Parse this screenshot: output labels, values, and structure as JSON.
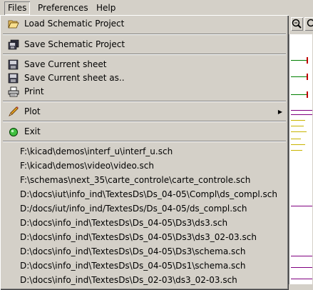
{
  "menubar": {
    "items": [
      {
        "label": "Files"
      },
      {
        "label": "Preferences"
      },
      {
        "label": "Help"
      }
    ]
  },
  "files_menu": {
    "load_project": {
      "label": "Load Schematic Project",
      "icon": "folder-open-icon"
    },
    "save_project": {
      "label": "Save Schematic Project",
      "icon": "save-all-icon"
    },
    "save_sheet": {
      "label": "Save Current sheet",
      "icon": "floppy-disk-icon"
    },
    "save_sheet_as": {
      "label": "Save Current sheet as..",
      "icon": "floppy-disk-icon"
    },
    "print": {
      "label": "Print",
      "icon": "printer-icon"
    },
    "plot": {
      "label": "Plot",
      "icon": "pencil-icon"
    },
    "exit": {
      "label": "Exit",
      "icon": "exit-icon"
    },
    "recent_files": [
      "F:\\kicad\\demos\\interf_u\\interf_u.sch",
      "F:\\kicad\\demos\\video\\video.sch",
      "F:\\schemas\\next_35\\carte_controle\\carte_controle.sch",
      "D:\\docs\\iut\\info_ind\\TextesDs\\Ds_04-05\\Compl\\ds_compl.sch",
      "D:/docs/iut/info_ind/TextesDs/Ds_04-05/ds_compl.sch",
      "D:\\docs\\info_ind\\TextesDs\\Ds_04-05\\Ds3\\ds3.sch",
      "D:\\docs\\info_ind\\TextesDs\\Ds_04-05\\Ds3\\ds3_02-03.sch",
      "D:\\docs\\info_ind\\TextesDs\\Ds_04-05\\Ds3\\schema.sch",
      "D:\\docs\\info_ind\\TextesDs\\Ds_04-05\\Ds1\\schema.sch",
      "D:\\docs\\info_ind\\TextesDs\\Ds_02-03\\ds3_02-03.sch"
    ]
  },
  "toolbar": {
    "zoom_icon": "zoom-icon"
  }
}
